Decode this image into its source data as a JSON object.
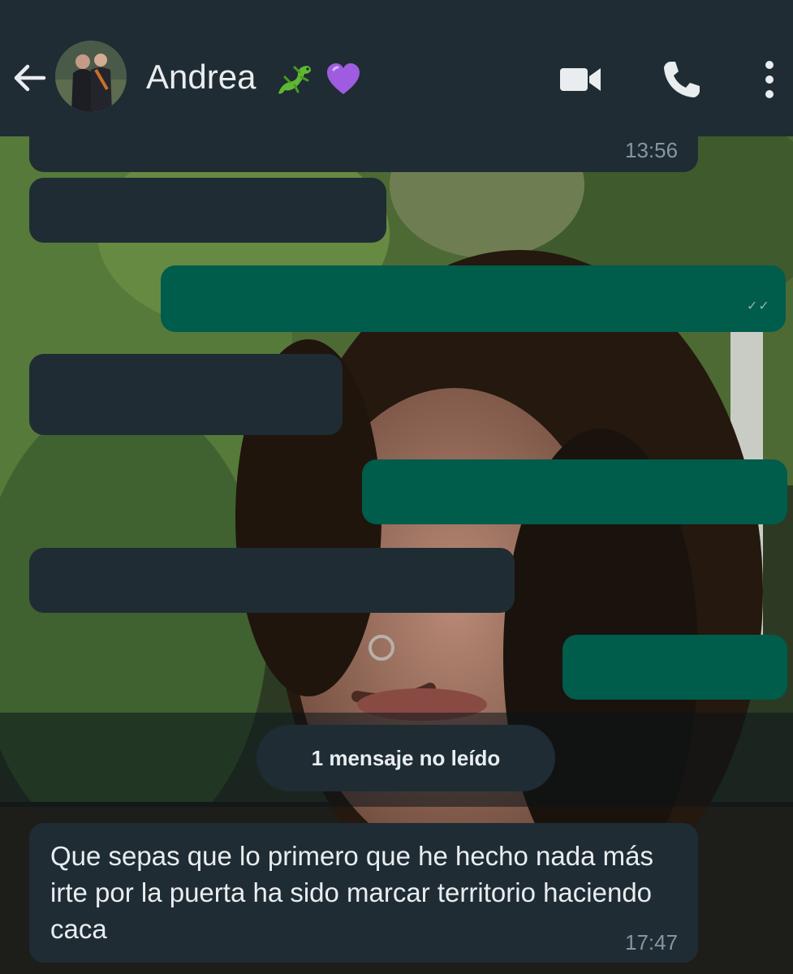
{
  "header": {
    "contact_name": "Andrea",
    "name_emojis": [
      "lizard",
      "purple-heart"
    ],
    "icons": [
      "back-arrow-icon",
      "video-call-icon",
      "voice-call-icon",
      "more-options-icon"
    ]
  },
  "conversation": {
    "messages": [
      {
        "direction": "incoming",
        "text": "",
        "time": "13:56",
        "redacted": true
      },
      {
        "direction": "incoming",
        "text": "",
        "redacted": true
      },
      {
        "direction": "outgoing",
        "text": "",
        "redacted": true
      },
      {
        "direction": "incoming",
        "text": "",
        "redacted": true
      },
      {
        "direction": "outgoing",
        "text": "",
        "redacted": true
      },
      {
        "direction": "incoming",
        "text": "",
        "redacted": true
      },
      {
        "direction": "outgoing",
        "text": "",
        "redacted": true
      }
    ],
    "unread_label": "1 mensaje no leído",
    "last_message": {
      "direction": "incoming",
      "text": "Que sepas que lo primero que he hecho nada más irte por la puerta ha sido marcar territorio haciendo caca",
      "time": "17:47"
    }
  },
  "colors": {
    "header_bg": "#1f2c34",
    "incoming_bubble": "#1f2c34",
    "outgoing_bubble": "#005c4b",
    "text_primary": "#e9edef",
    "text_secondary": "#8696a0"
  }
}
